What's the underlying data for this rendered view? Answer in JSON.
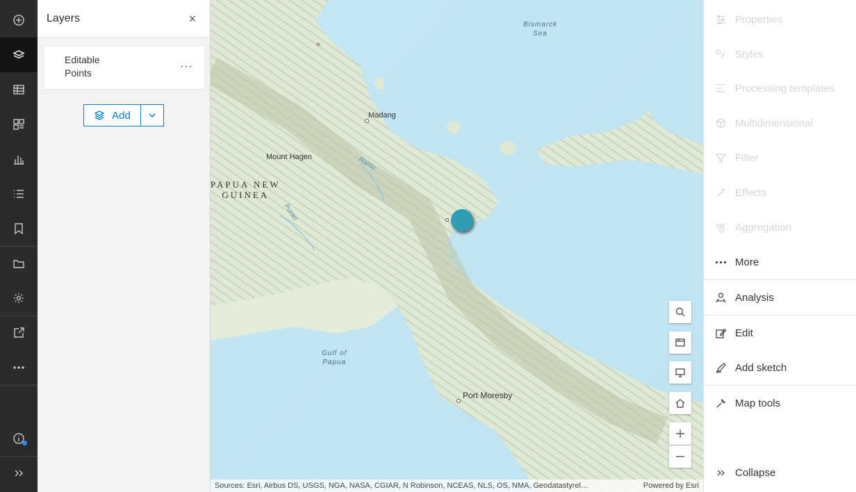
{
  "left_rail": {
    "items": [
      {
        "name": "add-icon"
      },
      {
        "name": "layers-icon",
        "active": true
      },
      {
        "name": "table-icon"
      },
      {
        "name": "legend-icon"
      },
      {
        "name": "charts-icon"
      },
      {
        "name": "list-icon"
      },
      {
        "name": "bookmark-icon"
      },
      {
        "name": "folder-icon"
      },
      {
        "name": "settings-icon"
      },
      {
        "name": "share-icon"
      },
      {
        "name": "more-icon"
      },
      {
        "name": "info-icon"
      },
      {
        "name": "expand-icon"
      }
    ]
  },
  "layers_panel": {
    "title": "Layers",
    "close_glyph": "×",
    "layers": [
      {
        "name": "Editable Points",
        "menu_glyph": "···"
      }
    ],
    "add_button_label": "Add"
  },
  "map": {
    "labels": {
      "sea_north": "Bismarck\nSea",
      "madang": "Madang",
      "mount_hagen": "Mount Hagen",
      "country": "PAPUA NEW\nGUINEA",
      "ramu": "Ramu",
      "purari": "Purari",
      "gulf": "Gulf of\nPapua",
      "port_moresby": "Port Moresby"
    },
    "feature_color": "#2f9db3",
    "attribution_sources": "Sources: Esri, Airbus DS, USGS, NGA, NASA, CGIAR, N Robinson, NCEAS, NLS, OS, NMA, Geodatastyrel…",
    "attribution_powered": "Powered by Esri"
  },
  "right_panel": {
    "items": [
      {
        "label": "Properties",
        "icon": "properties-icon",
        "disabled": true
      },
      {
        "label": "Styles",
        "icon": "styles-icon",
        "disabled": true
      },
      {
        "label": "Processing templates",
        "icon": "processing-templates-icon",
        "disabled": true
      },
      {
        "label": "Multidimensional",
        "icon": "multidimensional-icon",
        "disabled": true
      },
      {
        "label": "Filter",
        "icon": "filter-icon",
        "disabled": true
      },
      {
        "label": "Effects",
        "icon": "effects-icon",
        "disabled": true
      },
      {
        "label": "Aggregation",
        "icon": "aggregation-icon",
        "disabled": true
      },
      {
        "label": "More",
        "icon": "more-icon",
        "disabled": false
      },
      {
        "label": "Analysis",
        "icon": "analysis-icon",
        "disabled": false
      },
      {
        "label": "Edit",
        "icon": "edit-icon",
        "disabled": false
      },
      {
        "label": "Add sketch",
        "icon": "sketch-icon",
        "disabled": false
      },
      {
        "label": "Map tools",
        "icon": "wrench-icon",
        "disabled": false
      },
      {
        "label": "Collapse",
        "icon": "collapse-icon",
        "disabled": false
      }
    ]
  }
}
